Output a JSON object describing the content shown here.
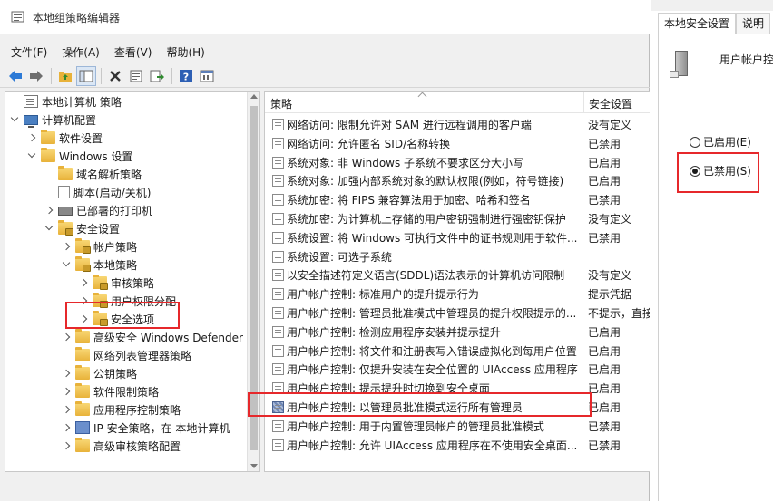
{
  "window": {
    "title": "本地组策略编辑器"
  },
  "menu": [
    "文件(F)",
    "操作(A)",
    "查看(V)",
    "帮助(H)"
  ],
  "toolbar_icons": [
    "back-arrow-icon",
    "forward-arrow-icon",
    "up-folder-icon",
    "show-hide-tree-icon",
    "delete-icon",
    "properties-icon",
    "export-icon",
    "help-icon",
    "console-icon"
  ],
  "tree": [
    {
      "label": "本地计算机 策略",
      "level": 0,
      "expander": "none",
      "icon": "policy"
    },
    {
      "label": "计算机配置",
      "level": 0,
      "expander": "open",
      "icon": "computer"
    },
    {
      "label": "软件设置",
      "level": 1,
      "expander": "closed",
      "icon": "folder"
    },
    {
      "label": "Windows 设置",
      "level": 1,
      "expander": "open",
      "icon": "folder"
    },
    {
      "label": "域名解析策略",
      "level": 2,
      "expander": "none",
      "icon": "folder"
    },
    {
      "label": "脚本(启动/关机)",
      "level": 2,
      "expander": "none",
      "icon": "doc"
    },
    {
      "label": "已部署的打印机",
      "level": 2,
      "expander": "closed",
      "icon": "printer"
    },
    {
      "label": "安全设置",
      "level": 2,
      "expander": "open",
      "icon": "folder-lock"
    },
    {
      "label": "帐户策略",
      "level": 3,
      "expander": "closed",
      "icon": "folder-lock"
    },
    {
      "label": "本地策略",
      "level": 3,
      "expander": "open",
      "icon": "folder-lock"
    },
    {
      "label": "审核策略",
      "level": 4,
      "expander": "closed",
      "icon": "folder-lock"
    },
    {
      "label": "用户权限分配",
      "level": 4,
      "expander": "closed",
      "icon": "folder-lock"
    },
    {
      "label": "安全选项",
      "level": 4,
      "expander": "closed",
      "icon": "folder-lock"
    },
    {
      "label": "高级安全 Windows Defender",
      "level": 3,
      "expander": "closed",
      "icon": "folder"
    },
    {
      "label": "网络列表管理器策略",
      "level": 3,
      "expander": "none",
      "icon": "folder"
    },
    {
      "label": "公钥策略",
      "level": 3,
      "expander": "closed",
      "icon": "folder"
    },
    {
      "label": "软件限制策略",
      "level": 3,
      "expander": "closed",
      "icon": "folder"
    },
    {
      "label": "应用程序控制策略",
      "level": 3,
      "expander": "closed",
      "icon": "folder"
    },
    {
      "label": "IP 安全策略，在 本地计算机",
      "level": 3,
      "expander": "closed",
      "icon": "shield"
    },
    {
      "label": "高级审核策略配置",
      "level": 3,
      "expander": "closed",
      "icon": "folder"
    }
  ],
  "list": {
    "columns": [
      "策略",
      "安全设置"
    ],
    "rows": [
      {
        "name": "网络访问: 限制允许对 SAM 进行远程调用的客户端",
        "setting": "没有定义"
      },
      {
        "name": "网络访问: 允许匿名 SID/名称转换",
        "setting": "已禁用"
      },
      {
        "name": "系统对象: 非 Windows 子系统不要求区分大小写",
        "setting": "已启用"
      },
      {
        "name": "系统对象: 加强内部系统对象的默认权限(例如，符号链接)",
        "setting": "已启用"
      },
      {
        "name": "系统加密: 将 FIPS 兼容算法用于加密、哈希和签名",
        "setting": "已禁用"
      },
      {
        "name": "系统加密: 为计算机上存储的用户密钥强制进行强密钥保护",
        "setting": "没有定义"
      },
      {
        "name": "系统设置: 将 Windows 可执行文件中的证书规则用于软件...",
        "setting": "已禁用"
      },
      {
        "name": "系统设置: 可选子系统",
        "setting": ""
      },
      {
        "name": "以安全描述符定义语言(SDDL)语法表示的计算机访问限制",
        "setting": "没有定义"
      },
      {
        "name": "用户帐户控制: 标准用户的提升提示行为",
        "setting": "提示凭据"
      },
      {
        "name": "用户帐户控制: 管理员批准模式中管理员的提升权限提示的...",
        "setting": "不提示，直接"
      },
      {
        "name": "用户帐户控制: 检测应用程序安装并提示提升",
        "setting": "已启用"
      },
      {
        "name": "用户帐户控制: 将文件和注册表写入错误虚拟化到每用户位置",
        "setting": "已启用"
      },
      {
        "name": "用户帐户控制: 仅提升安装在安全位置的 UIAccess 应用程序",
        "setting": "已启用"
      },
      {
        "name": "用户帐户控制: 提示提升时切换到安全桌面",
        "setting": "已启用"
      },
      {
        "name": "用户帐户控制: 以管理员批准模式运行所有管理员",
        "setting": "已启用",
        "selected": true
      },
      {
        "name": "用户帐户控制: 用于内置管理员帐户的管理员批准模式",
        "setting": "已禁用"
      },
      {
        "name": "用户帐户控制: 允许 UIAccess 应用程序在不使用安全桌面...",
        "setting": "已禁用"
      }
    ]
  },
  "props": {
    "tabs": [
      "本地安全设置",
      "说明"
    ],
    "title": "用户帐户控",
    "options": [
      {
        "label": "已启用(E)",
        "checked": false
      },
      {
        "label": "已禁用(S)",
        "checked": true
      }
    ]
  },
  "highlight_color": "#e6282b"
}
